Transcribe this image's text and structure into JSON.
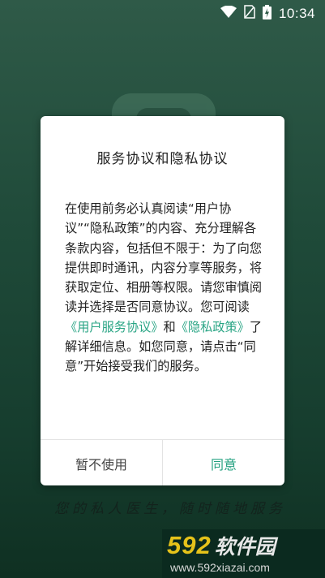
{
  "status_bar": {
    "time": "10:34",
    "icons": [
      "wifi-icon",
      "sim-icon",
      "battery-icon"
    ]
  },
  "dialog": {
    "title": "服务协议和隐私协议",
    "body_part1": "在使用前务必认真阅读“用户协议”“隐私政策”的内容、充分理解各条款内容，包括但不限于：为了向您提供即时通讯，内容分享等服务，将获取定位、相册等权限。请您审慎阅读并选择是否同意协议。您可阅读",
    "link_user_agreement": "《用户服务协议》",
    "body_and": "和",
    "link_privacy": "《隐私政策》",
    "body_part2": "了解详细信息。如您同意，请点击“同意”开始接受我们的服务。",
    "decline_label": "暂不使用",
    "agree_label": "同意"
  },
  "slogan": "您的私人医生，随时随地服务",
  "watermark": {
    "number": "592",
    "name": "软件园",
    "url": "www.592xiazai.com"
  },
  "colors": {
    "accent": "#22a07f",
    "background": "#1f4a39"
  }
}
